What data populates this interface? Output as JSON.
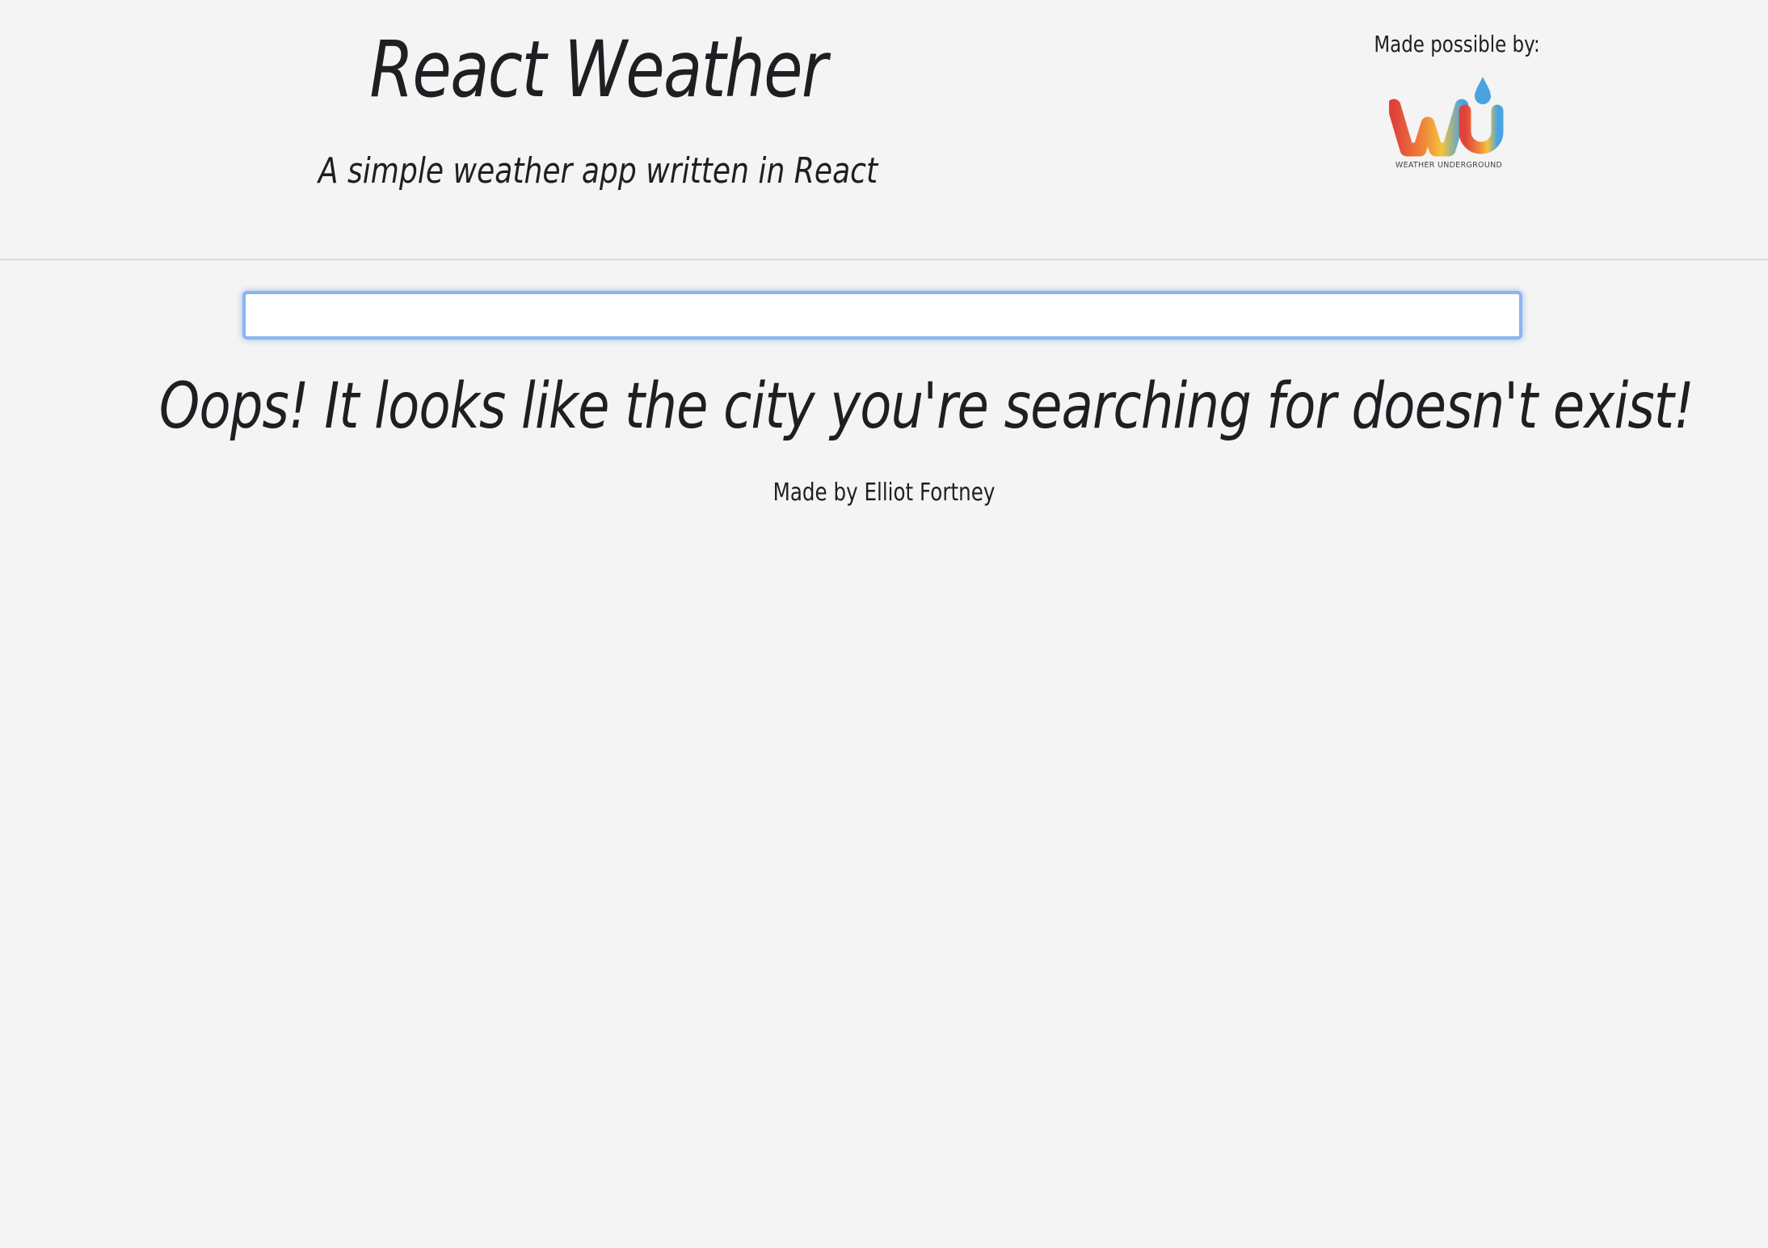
{
  "header": {
    "title": "React Weather",
    "subtitle": "A simple weather app written in React",
    "sponsor_label": "Made possible by:",
    "sponsor_logo": {
      "icon": "weather-underground-logo",
      "text": "WEATHER UNDERGROUND",
      "colors": [
        "#e0413a",
        "#f0893a",
        "#f6c33b",
        "#4aa3e0"
      ]
    }
  },
  "search": {
    "value": "",
    "placeholder": "",
    "focus_color": "#8cb4f0"
  },
  "main": {
    "error_message": "Oops! It looks like the city you're searching for doesn't exist!"
  },
  "footer": {
    "credit": "Made by Elliot Fortney"
  },
  "colors": {
    "background": "#f4f4f4",
    "text": "#1f1f23"
  }
}
